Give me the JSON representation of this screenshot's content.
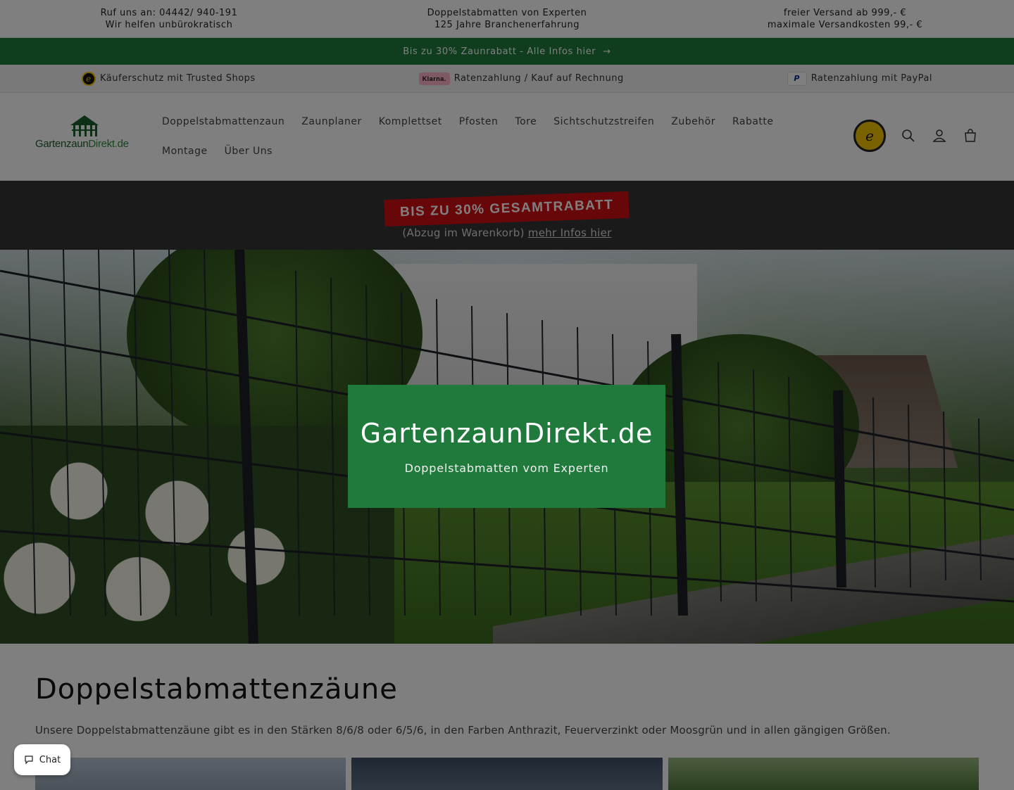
{
  "infobar": {
    "col1_line1": "Ruf uns an: 04442/ 940-191",
    "col1_line2": "Wir helfen unbürokratisch",
    "col2_line1": "Doppelstabmatten von Experten",
    "col2_line2": "125 Jahre Branchenerfahrung",
    "col3_line1": "freier Versand ab 999,- €",
    "col3_line2": "maximale Versandkosten 99,- €"
  },
  "announcement": {
    "text": "Bis zu 30% Zaunrabatt - Alle Infos hier",
    "arrow": "→"
  },
  "trust": {
    "item1": "Käuferschutz mit Trusted Shops",
    "item2": "Ratenzahlung / Kauf auf Rechnung",
    "item2_badge": "Klarna.",
    "item3": "Ratenzahlung mit PayPal",
    "item3_badge": "P"
  },
  "header": {
    "logo_part1": "Gartenzaun",
    "logo_part2": "Direkt.de",
    "nav": [
      "Doppelstabmattenzaun",
      "Zaunplaner",
      "Komplettset",
      "Pfosten",
      "Tore",
      "Sichtschutzstreifen",
      "Zubehör",
      "Rabatte",
      "Montage",
      "Über Uns"
    ],
    "seal_letter": "e"
  },
  "promo": {
    "tag": "BIS ZU 30% GESAMTRABATT",
    "sub_prefix": "(Abzug im Warenkorb)",
    "sub_link": "mehr Infos hier"
  },
  "hero": {
    "title": "GartenzaunDirekt.de",
    "subtitle": "Doppelstabmatten vom Experten"
  },
  "section": {
    "title": "Doppelstabmattenzäune",
    "text": "Unsere Doppelstabmattenzäune gibt es in den Stärken 8/6/8 oder 6/5/6, in den Farben Anthrazit, Feuerverzinkt oder Moosgrün und in allen gängigen Größen."
  },
  "chat": {
    "label": "Chat"
  },
  "colors": {
    "brand_green": "#1f7a3c",
    "promo_red": "#d10f15",
    "promo_bg": "#353535"
  }
}
